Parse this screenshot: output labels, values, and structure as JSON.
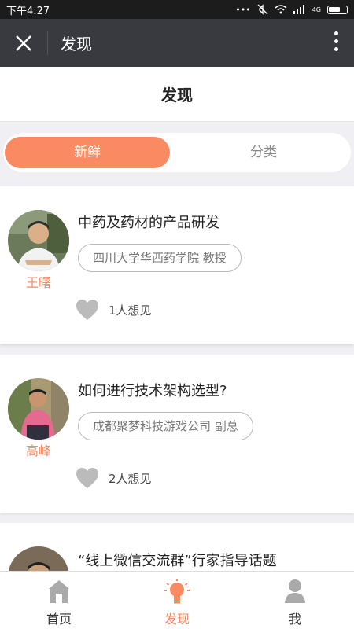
{
  "status_bar": {
    "time": "下午4:27",
    "network": "4G"
  },
  "title_bar": {
    "title": "发现"
  },
  "page": {
    "title": "发现"
  },
  "segments": {
    "active": "新鲜",
    "inactive": "分类"
  },
  "cards": [
    {
      "title": "中药及药材的产品研发",
      "tag": "四川大学华西药学院 教授",
      "name": "王曙",
      "likes": "1人想见"
    },
    {
      "title": "如何进行技术架构选型?",
      "tag": "成都聚梦科技游戏公司 副总",
      "name": "高峰",
      "likes": "2人想见"
    },
    {
      "title": "“线上微信交流群”行家指导话题"
    }
  ],
  "tabbar": {
    "items": [
      {
        "label": "首页"
      },
      {
        "label": "发现"
      },
      {
        "label": "我"
      }
    ]
  },
  "colors": {
    "accent": "#fa8a61",
    "titlebar": "#393a3f",
    "statusbar": "#1c1c1c"
  }
}
